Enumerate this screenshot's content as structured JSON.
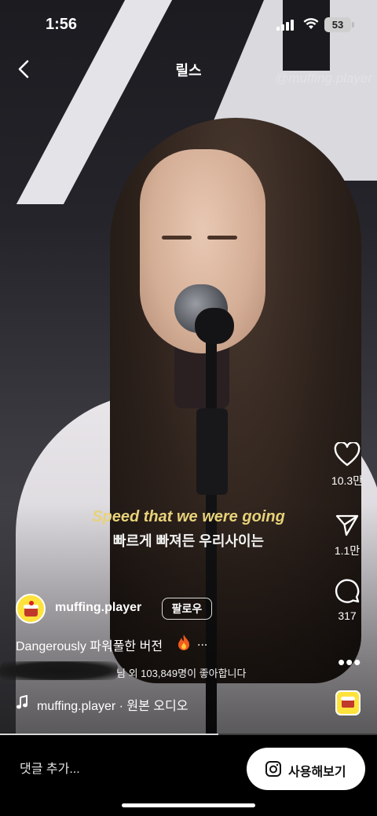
{
  "status_bar": {
    "time": "1:56",
    "battery": "53"
  },
  "header": {
    "title": "릴스"
  },
  "video": {
    "watermark": "@muffing.player",
    "subtitle_en": "Speed that we were going",
    "subtitle_ko": "빠르게 빠져든 우리사이는",
    "progress": 0.58
  },
  "actions": {
    "likes": "10.3만",
    "shares": "1.1만",
    "comments": "317"
  },
  "post": {
    "username": "muffing.player",
    "follow_label": "팔로우",
    "caption": "Dangerously 파워풀한 버전",
    "caption_more": "...",
    "likes_text": "님 외 103,849명이 좋아합니다",
    "audio": "muffing.player · 원본 오디오"
  },
  "bottom": {
    "comment_placeholder": "댓글 추가...",
    "use_label": "사용해보기"
  },
  "colors": {
    "accent_yellow": "#ffe23c",
    "subtitle_en": "#e8d27a"
  }
}
